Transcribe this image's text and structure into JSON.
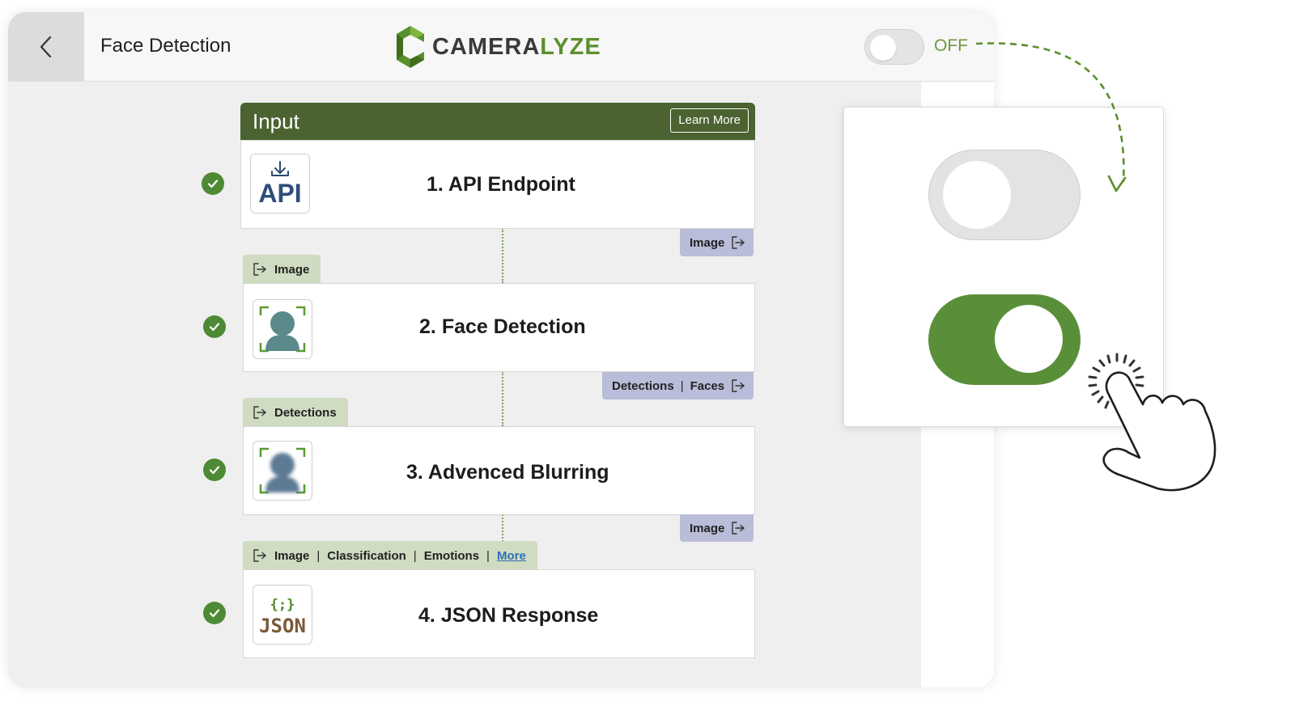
{
  "header": {
    "back_label": "Back",
    "title": "Face Detection",
    "brand": {
      "part1": "CAMERA",
      "part2": "LYZE"
    },
    "toggle_state_label": "OFF"
  },
  "input_section": {
    "title": "Input",
    "learn_more_label": "Learn More"
  },
  "pipeline": [
    {
      "number": "1.",
      "title": "API Endpoint",
      "icon": "api-icon",
      "icon_text": "API",
      "status": "complete"
    },
    {
      "number": "2.",
      "title": "Face Detection",
      "icon": "face-detection-icon",
      "status": "complete"
    },
    {
      "number": "3.",
      "title": "Advenced Blurring",
      "icon": "blurred-face-icon",
      "status": "complete"
    },
    {
      "number": "4.",
      "title": "JSON Response",
      "icon": "json-icon",
      "icon_text_top": "{;}",
      "icon_text": "JSON",
      "status": "complete"
    }
  ],
  "outputs": {
    "step1": [
      "Image"
    ],
    "step2": [
      "Detections",
      "Faces"
    ],
    "step3": [
      "Image"
    ]
  },
  "inputs": {
    "step2": [
      "Image"
    ],
    "step3": [
      "Detections"
    ],
    "step4": [
      "Image",
      "Classification",
      "Emotions"
    ],
    "step4_more_label": "More"
  },
  "colors": {
    "brand_green": "#5a8f3a",
    "header_green": "#4a6331",
    "output_tag": "#b9bdd9",
    "input_tag": "#cfdcc1",
    "check_green": "#4e8a35"
  },
  "toggles": {
    "header_toggle_on": false,
    "example_off_toggle_on": false,
    "example_on_toggle_on": true
  }
}
